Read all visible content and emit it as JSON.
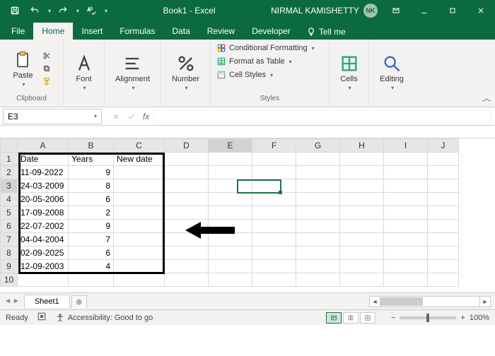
{
  "title": {
    "document": "Book1  -  Excel",
    "user": "NIRMAL KAMISHETTY",
    "avatar": "NK"
  },
  "tabs": {
    "file": "File",
    "home": "Home",
    "insert": "Insert",
    "formulas": "Formulas",
    "data": "Data",
    "review": "Review",
    "developer": "Developer",
    "tellme": "Tell me"
  },
  "ribbon": {
    "clipboard": {
      "paste": "Paste",
      "label": "Clipboard"
    },
    "font": {
      "btn": "Font"
    },
    "alignment": {
      "btn": "Alignment"
    },
    "number": {
      "btn": "Number"
    },
    "styles": {
      "cond": "Conditional Formatting",
      "table": "Format as Table",
      "cell": "Cell Styles",
      "label": "Styles"
    },
    "cells": {
      "btn": "Cells"
    },
    "editing": {
      "btn": "Editing"
    }
  },
  "namebox": "E3",
  "columns": [
    "A",
    "B",
    "C",
    "D",
    "E",
    "F",
    "G",
    "H",
    "I",
    "J"
  ],
  "rows": [
    "1",
    "2",
    "3",
    "4",
    "5",
    "6",
    "7",
    "8",
    "9",
    "10"
  ],
  "headers": {
    "a": "Date",
    "b": "Years",
    "c": "New date"
  },
  "data": [
    {
      "date": "11-09-2022",
      "years": "9"
    },
    {
      "date": "24-03-2009",
      "years": "8"
    },
    {
      "date": "20-05-2006",
      "years": "6"
    },
    {
      "date": "17-09-2008",
      "years": "2"
    },
    {
      "date": "22-07-2002",
      "years": "9"
    },
    {
      "date": "04-04-2004",
      "years": "7"
    },
    {
      "date": "02-09-2025",
      "years": "6"
    },
    {
      "date": "12-09-2003",
      "years": "4"
    }
  ],
  "sheet": {
    "name": "Sheet1"
  },
  "status": {
    "ready": "Ready",
    "acc": "Accessibility: Good to go",
    "zoom": "100%"
  }
}
